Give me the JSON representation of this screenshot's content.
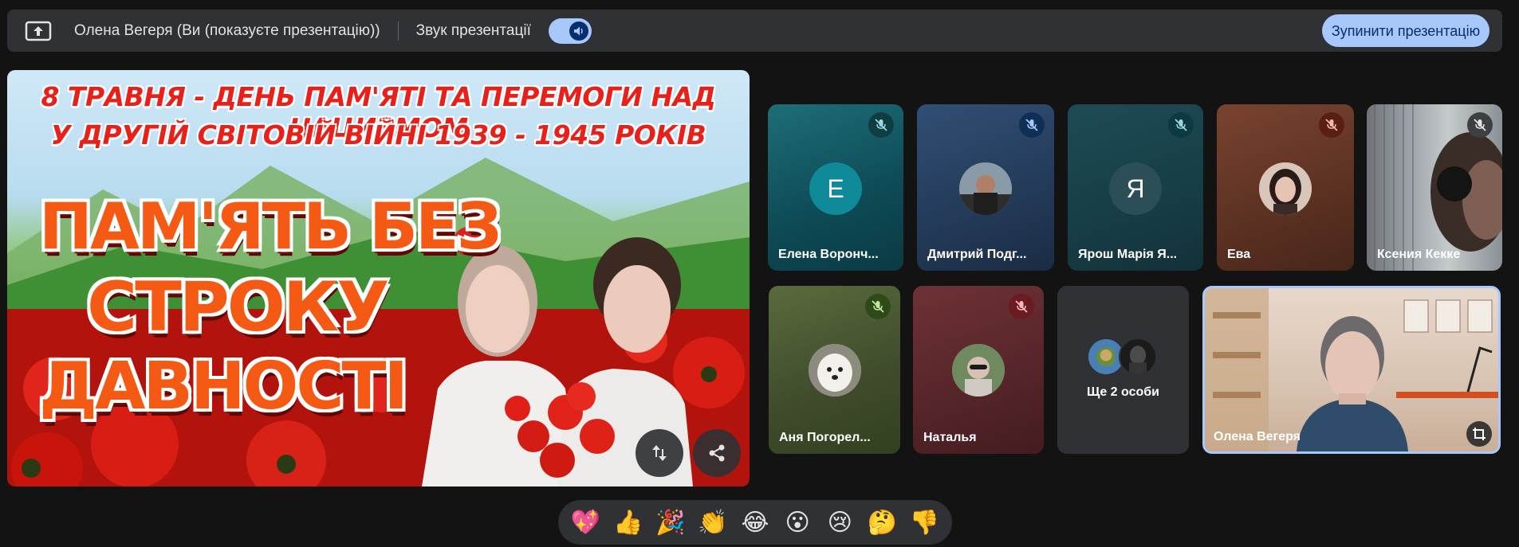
{
  "banner": {
    "presenter_text": "Олена Вегеря (Ви (показуєте презентацію))",
    "sound_label": "Звук презентації",
    "sound_toggle_on": true,
    "stop_button_label": "Зупинити презентацію",
    "present_icon": "present-to-all-icon",
    "speaker_icon": "volume-up-icon"
  },
  "presentation": {
    "headline_line1": "8 ТРАВНЯ - ДЕНЬ ПАМ'ЯТІ ТА ПЕРЕМОГИ НАД НАЦИЗМОМ",
    "headline_line2": "У ДРУГІЙ СВІТОВІЙ ВІЙНІ 1939 - 1945 РОКІВ",
    "big_line1": "ПАМ'ЯТЬ БЕЗ",
    "big_line2": "СТРОКУ",
    "big_line3": "ДАВНОСТІ",
    "buttons": [
      "swap-layout-icon",
      "share-icon"
    ]
  },
  "participants": [
    {
      "name": "Елена Ворончук",
      "display": "Елена Воронч...",
      "initial": "Е",
      "muted": true,
      "avatar": "initial"
    },
    {
      "name": "Дмитрий Подгорный",
      "display": "Дмитрий Подг...",
      "muted": true,
      "avatar": "photo"
    },
    {
      "name": "Ярош Марія",
      "display": "Ярош Марія Я...",
      "initial": "Я",
      "muted": true,
      "avatar": "initial"
    },
    {
      "name": "Ева",
      "display": "Ева",
      "muted": true,
      "avatar": "photo"
    },
    {
      "name": "Ксения Кекке",
      "display": "Ксения Кекке",
      "muted": true,
      "avatar": "video"
    },
    {
      "name": "Аня Погорелова",
      "display": "Аня Погорел...",
      "muted": true,
      "avatar": "photo"
    },
    {
      "name": "Натальяя",
      "display": "Наталья",
      "muted": true,
      "avatar": "photo"
    }
  ],
  "more_tile": {
    "label": "Ще 2 особи"
  },
  "self_tile": {
    "name": "Олена Вегеря",
    "icon": "crop-icon"
  },
  "reactions": [
    "💖",
    "👍",
    "🎉",
    "👏",
    "😂",
    "😮",
    "😢",
    "🤔",
    "👎"
  ],
  "colors": {
    "background": "#131314",
    "accent": "#a8c7fa",
    "accent_dark": "#062e6f",
    "surface": "#303134"
  }
}
